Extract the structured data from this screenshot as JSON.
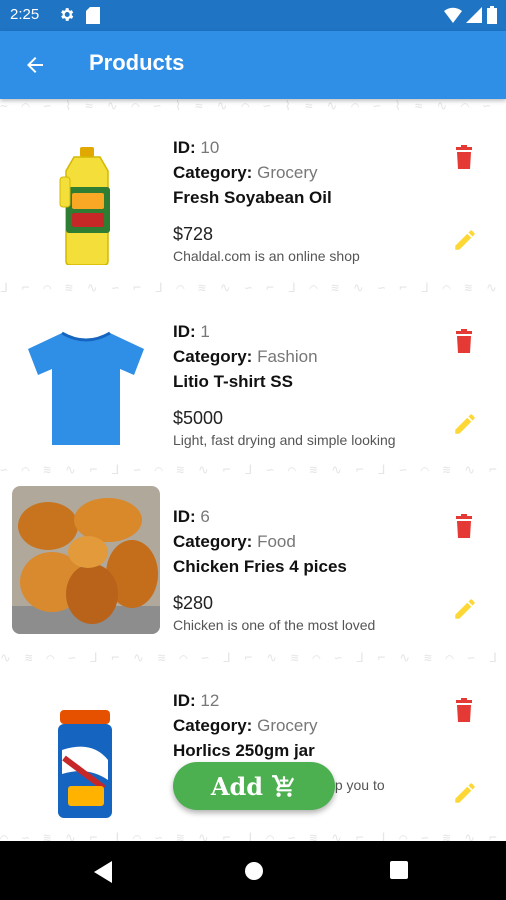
{
  "status": {
    "time": "2:25"
  },
  "appbar": {
    "title": "Products"
  },
  "labels": {
    "id": "ID:",
    "category": "Category:"
  },
  "products": [
    {
      "id": "10",
      "category": "Grocery",
      "name": "Fresh Soyabean Oil",
      "price": "$728",
      "description": "Chaldal.com is an online shop",
      "image": "oil-bottle"
    },
    {
      "id": "1",
      "category": "Fashion",
      "name": "Litio T-shirt SS",
      "price": "$5000",
      "description": "Light, fast drying and simple looking",
      "image": "blue-tshirt"
    },
    {
      "id": "6",
      "category": "Food",
      "name": "Chicken Fries 4 pices",
      "price": "$280",
      "description": "Chicken is one of the most loved",
      "image": "fried-chicken"
    },
    {
      "id": "12",
      "category": "Grocery",
      "name": "Horlics 250gm jar",
      "price": "",
      "description": "Horlicks 250gm jar will help you to",
      "image": "horlicks-jar"
    }
  ],
  "fab": {
    "label": "Add"
  },
  "colors": {
    "statusbar": "#1f74c4",
    "appbar": "#2f8ee6",
    "delete": "#e53935",
    "edit": "#fdd835",
    "fab": "#4caf50"
  },
  "icons": [
    "back-arrow-icon",
    "gear-icon",
    "sd-card-icon",
    "wifi-icon",
    "signal-icon",
    "battery-icon",
    "delete-icon",
    "edit-icon",
    "cart-icon",
    "nav-back-icon",
    "nav-home-icon",
    "nav-recents-icon"
  ]
}
